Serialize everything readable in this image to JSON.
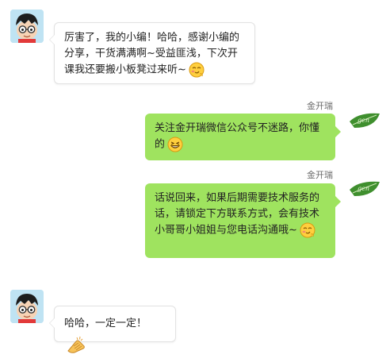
{
  "messages": [
    {
      "side": "left",
      "avatar": "cartoon-boy-avatar",
      "text": "厉害了，我的小编！哈哈，感谢小编的分享，干货满满啊~受益匪浅，下次开课我还要搬小板凳过来听~",
      "emoji": "blush-emoji"
    },
    {
      "side": "right",
      "sender": "金开瑞",
      "avatar": "company-logo-avatar",
      "text": "关注金开瑞微信公众号不迷路，你懂的",
      "emoji": "grin-emoji"
    },
    {
      "side": "right",
      "sender": "金开瑞",
      "avatar": "company-logo-avatar",
      "text": "话说回来，如果后期需要技术服务的话，请锁定下方联系方式，会有技术小哥哥小姐姐与您电话沟通哦~",
      "emoji": "blush-emoji"
    },
    {
      "side": "left",
      "avatar": "cartoon-boy-avatar",
      "text": "哈哈，一定一定！",
      "emoji": "fist-bump-emoji"
    }
  ],
  "colors": {
    "right_bubble": "#9fe35f",
    "left_bubble": "#ffffff",
    "left_border": "#e2e2e2",
    "name_text": "#6b6b6b"
  }
}
